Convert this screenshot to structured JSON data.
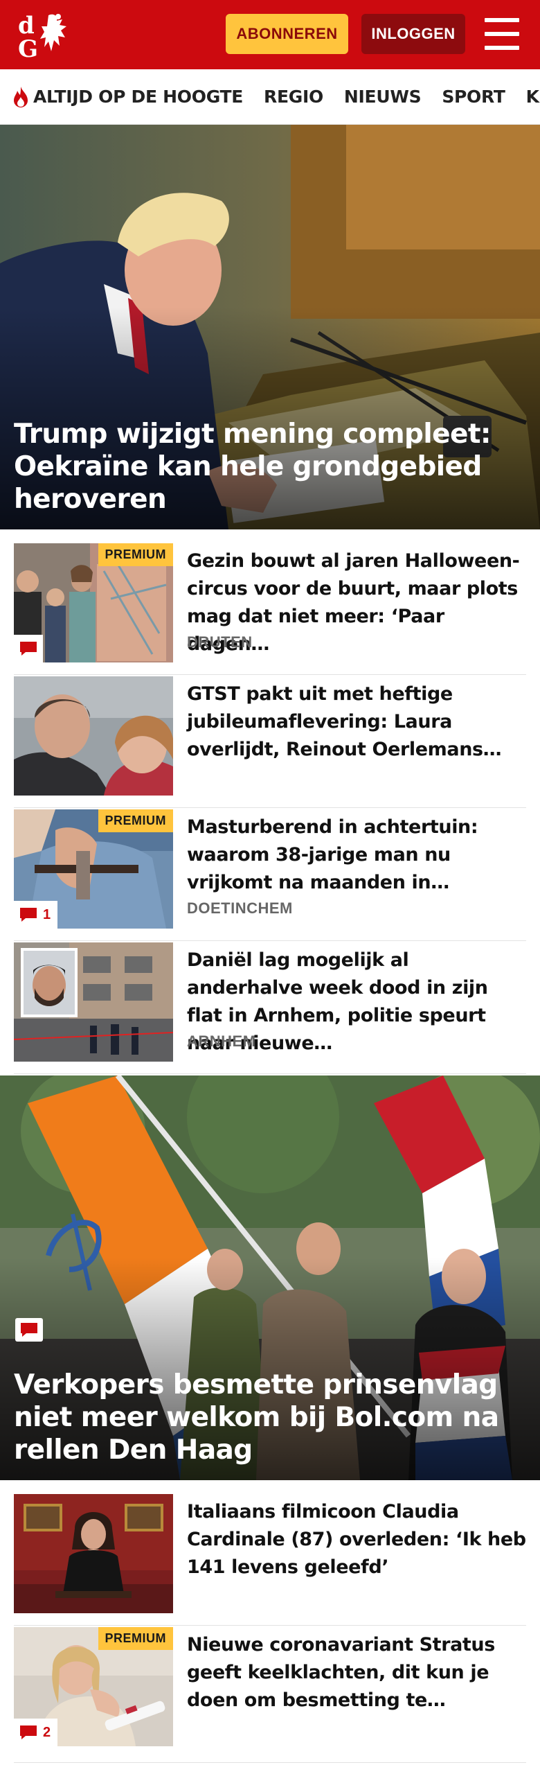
{
  "header": {
    "logo_alt": "dG",
    "subscribe_label": "ABONNEREN",
    "login_label": "INLOGGEN"
  },
  "nav": {
    "items": [
      "ALTIJD OP DE HOOGTE",
      "REGIO",
      "NIEUWS",
      "SPORT",
      "KIJK"
    ]
  },
  "colors": {
    "brand_red": "#cc0a0f",
    "accent_yellow": "#ffc43d"
  },
  "hero1": {
    "title": "Trump wijzigt mening compleet: Oekraïne kan hele grondgebied heroveren"
  },
  "articles1": [
    {
      "premium": "PREMIUM",
      "headline": "Gezin bouwt al jaren Halloween-circus voor de buurt, maar plots mag dat niet meer: ‘Paar dagen…",
      "place": "DRUTEN",
      "comments": ""
    },
    {
      "premium": "",
      "headline": "GTST pakt uit met heftige jubileumaflevering: Laura overlijdt, Reinout Oerlemans…",
      "place": "",
      "comments": ""
    },
    {
      "premium": "PREMIUM",
      "headline": "Masturberend in achtertuin: waarom 38-jarige man nu vrijkomt na maanden in…",
      "place": "DOETINCHEM",
      "comments": "1"
    },
    {
      "premium": "",
      "headline": "Daniël lag mogelijk al anderhalve week dood in zijn flat in Arnhem, politie speurt naar nieuwe…",
      "place": "ARNHEM",
      "comments": ""
    }
  ],
  "hero2": {
    "title": "Verkopers besmette prinsenvlag niet meer welkom bij Bol.com na rellen Den Haag"
  },
  "articles2": [
    {
      "premium": "",
      "headline": "Italiaans filmicoon Claudia Cardinale (87) overleden: ‘Ik heb 141 levens geleefd’",
      "place": "",
      "comments": ""
    },
    {
      "premium": "PREMIUM",
      "headline": "Nieuwe coronavariant Stratus geeft keelklachten, dit kun je doen om besmetting te…",
      "place": "",
      "comments": "2"
    }
  ]
}
